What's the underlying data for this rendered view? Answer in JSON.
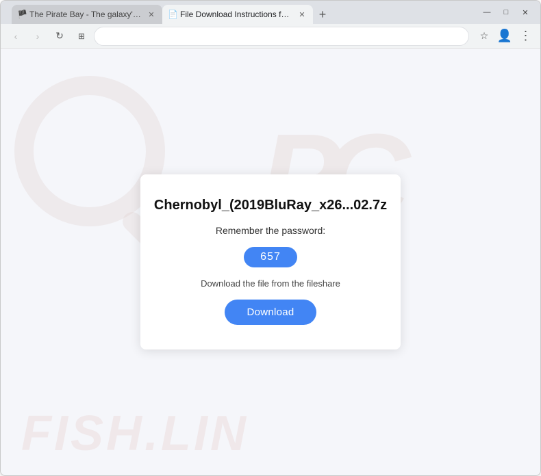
{
  "browser": {
    "tabs": [
      {
        "id": "tab-piratebay",
        "title": "The Pirate Bay - The galaxy's m...",
        "favicon": "🏴",
        "active": false
      },
      {
        "id": "tab-filedownload",
        "title": "File Download Instructions for...",
        "favicon": "📄",
        "active": true
      }
    ],
    "new_tab_label": "+",
    "nav": {
      "back": "‹",
      "forward": "›",
      "refresh": "↻",
      "extensions": "⊞"
    },
    "omnibox_value": "",
    "toolbar": {
      "bookmark": "☆",
      "profile": "👤",
      "menu": "⋮"
    }
  },
  "dialog": {
    "file_title": "Chernobyl_(2019BluRay_x26...02.7z",
    "password_label": "Remember the password:",
    "password_value": "657",
    "instruction": "Download the file from the fileshare",
    "download_button": "Download"
  },
  "watermark": {
    "text": "FISH.LIN"
  },
  "window_controls": {
    "minimize": "—",
    "maximize": "□",
    "close": "✕"
  }
}
